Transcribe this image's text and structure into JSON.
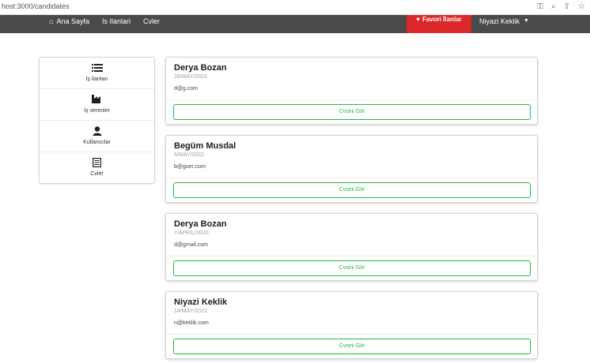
{
  "browser": {
    "url": "host:3000/candidates",
    "icons": [
      "key-icon",
      "zoom-icon",
      "share-icon",
      "star-icon"
    ]
  },
  "nav": {
    "home_label": "Ana Sayfa",
    "jobs_label": "Is Ilanlari",
    "cvs_label": "Cvler",
    "favorites_label": "Favori İlanlar",
    "user_label": "Niyazi Keklik",
    "favorites_color": "#db2828",
    "bar_color": "#4a4a4a"
  },
  "sidebar": {
    "items": [
      {
        "label": "İş ilanları",
        "icon": "list-icon"
      },
      {
        "label": "İş verenler",
        "icon": "industry-icon"
      },
      {
        "label": "Kullanıcılar",
        "icon": "user-icon"
      },
      {
        "label": "Cvler",
        "icon": "cv-icon"
      }
    ]
  },
  "candidates": [
    {
      "name": "Derya Bozan",
      "date": "28/MAY/2022",
      "email": "d@g.com",
      "button": "Cvsini Gör"
    },
    {
      "name": "Begüm Musdal",
      "date": "6/MAY/2022",
      "email": "b@gum.com",
      "button": "Cvsini Gör"
    },
    {
      "name": "Derya Bozan",
      "date": "7/APRIL/2020",
      "email": "d@gmail.com",
      "button": "Cvsini Gör"
    },
    {
      "name": "Niyazi Keklik",
      "date": "14/MAY/2022",
      "email": "n@keklik.com",
      "button": "Cvsini Gör"
    }
  ],
  "accent_color": "#21ba45"
}
